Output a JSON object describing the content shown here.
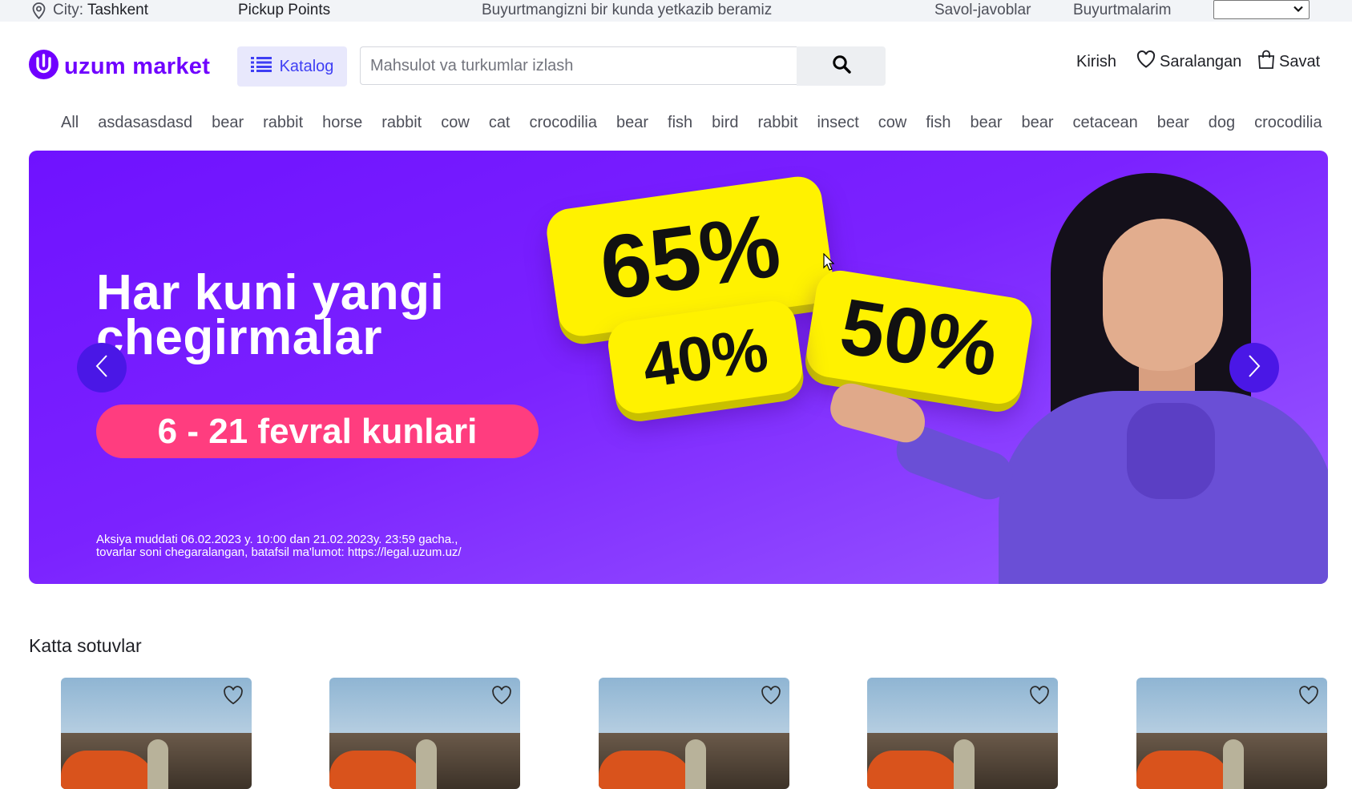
{
  "topbar": {
    "city_label": "City:",
    "city_value": "Tashkent",
    "pickup": "Pickup Points",
    "delivery": "Buyurtmangizni bir kunda yetkazib beramiz",
    "faq": "Savol-javoblar",
    "orders": "Buyurtmalarim",
    "language_value": ""
  },
  "header": {
    "logo_text": "uzum market",
    "catalog_label": "Katalog",
    "search_placeholder": "Mahsulot va turkumlar izlash",
    "login": "Kirish",
    "favorites": "Saralangan",
    "cart": "Savat"
  },
  "categories": [
    "All",
    "asdasasdasd",
    "bear",
    "rabbit",
    "horse",
    "rabbit",
    "cow",
    "cat",
    "crocodilia",
    "bear",
    "fish",
    "bird",
    "rabbit",
    "insect",
    "cow",
    "fish",
    "bear",
    "bear",
    "cetacean",
    "bear",
    "dog",
    "crocodilia"
  ],
  "banner": {
    "headline_line1": "Har kuni yangi",
    "headline_line2": "chegirmalar",
    "tag_65": "65%",
    "tag_40": "40%",
    "tag_50": "50%",
    "dates": "6 - 21 fevral kunlari",
    "fine_line1": "Aksiya muddati 06.02.2023 y. 10:00 dan 21.02.2023y. 23:59 gacha.,",
    "fine_line2": "tovarlar soni chegaralangan, batafsil ma'lumot: https://legal.uzum.uz/",
    "bg_color": "#7b22ff",
    "accent_yellow": "#fff200",
    "accent_pink": "#ff3d7f"
  },
  "section": {
    "title": "Katta sotuvlar",
    "card_count": 5
  },
  "colors": {
    "brand": "#7000ff",
    "catalog_bg": "#e8e8fc",
    "catalog_text": "#3e3ef4"
  }
}
